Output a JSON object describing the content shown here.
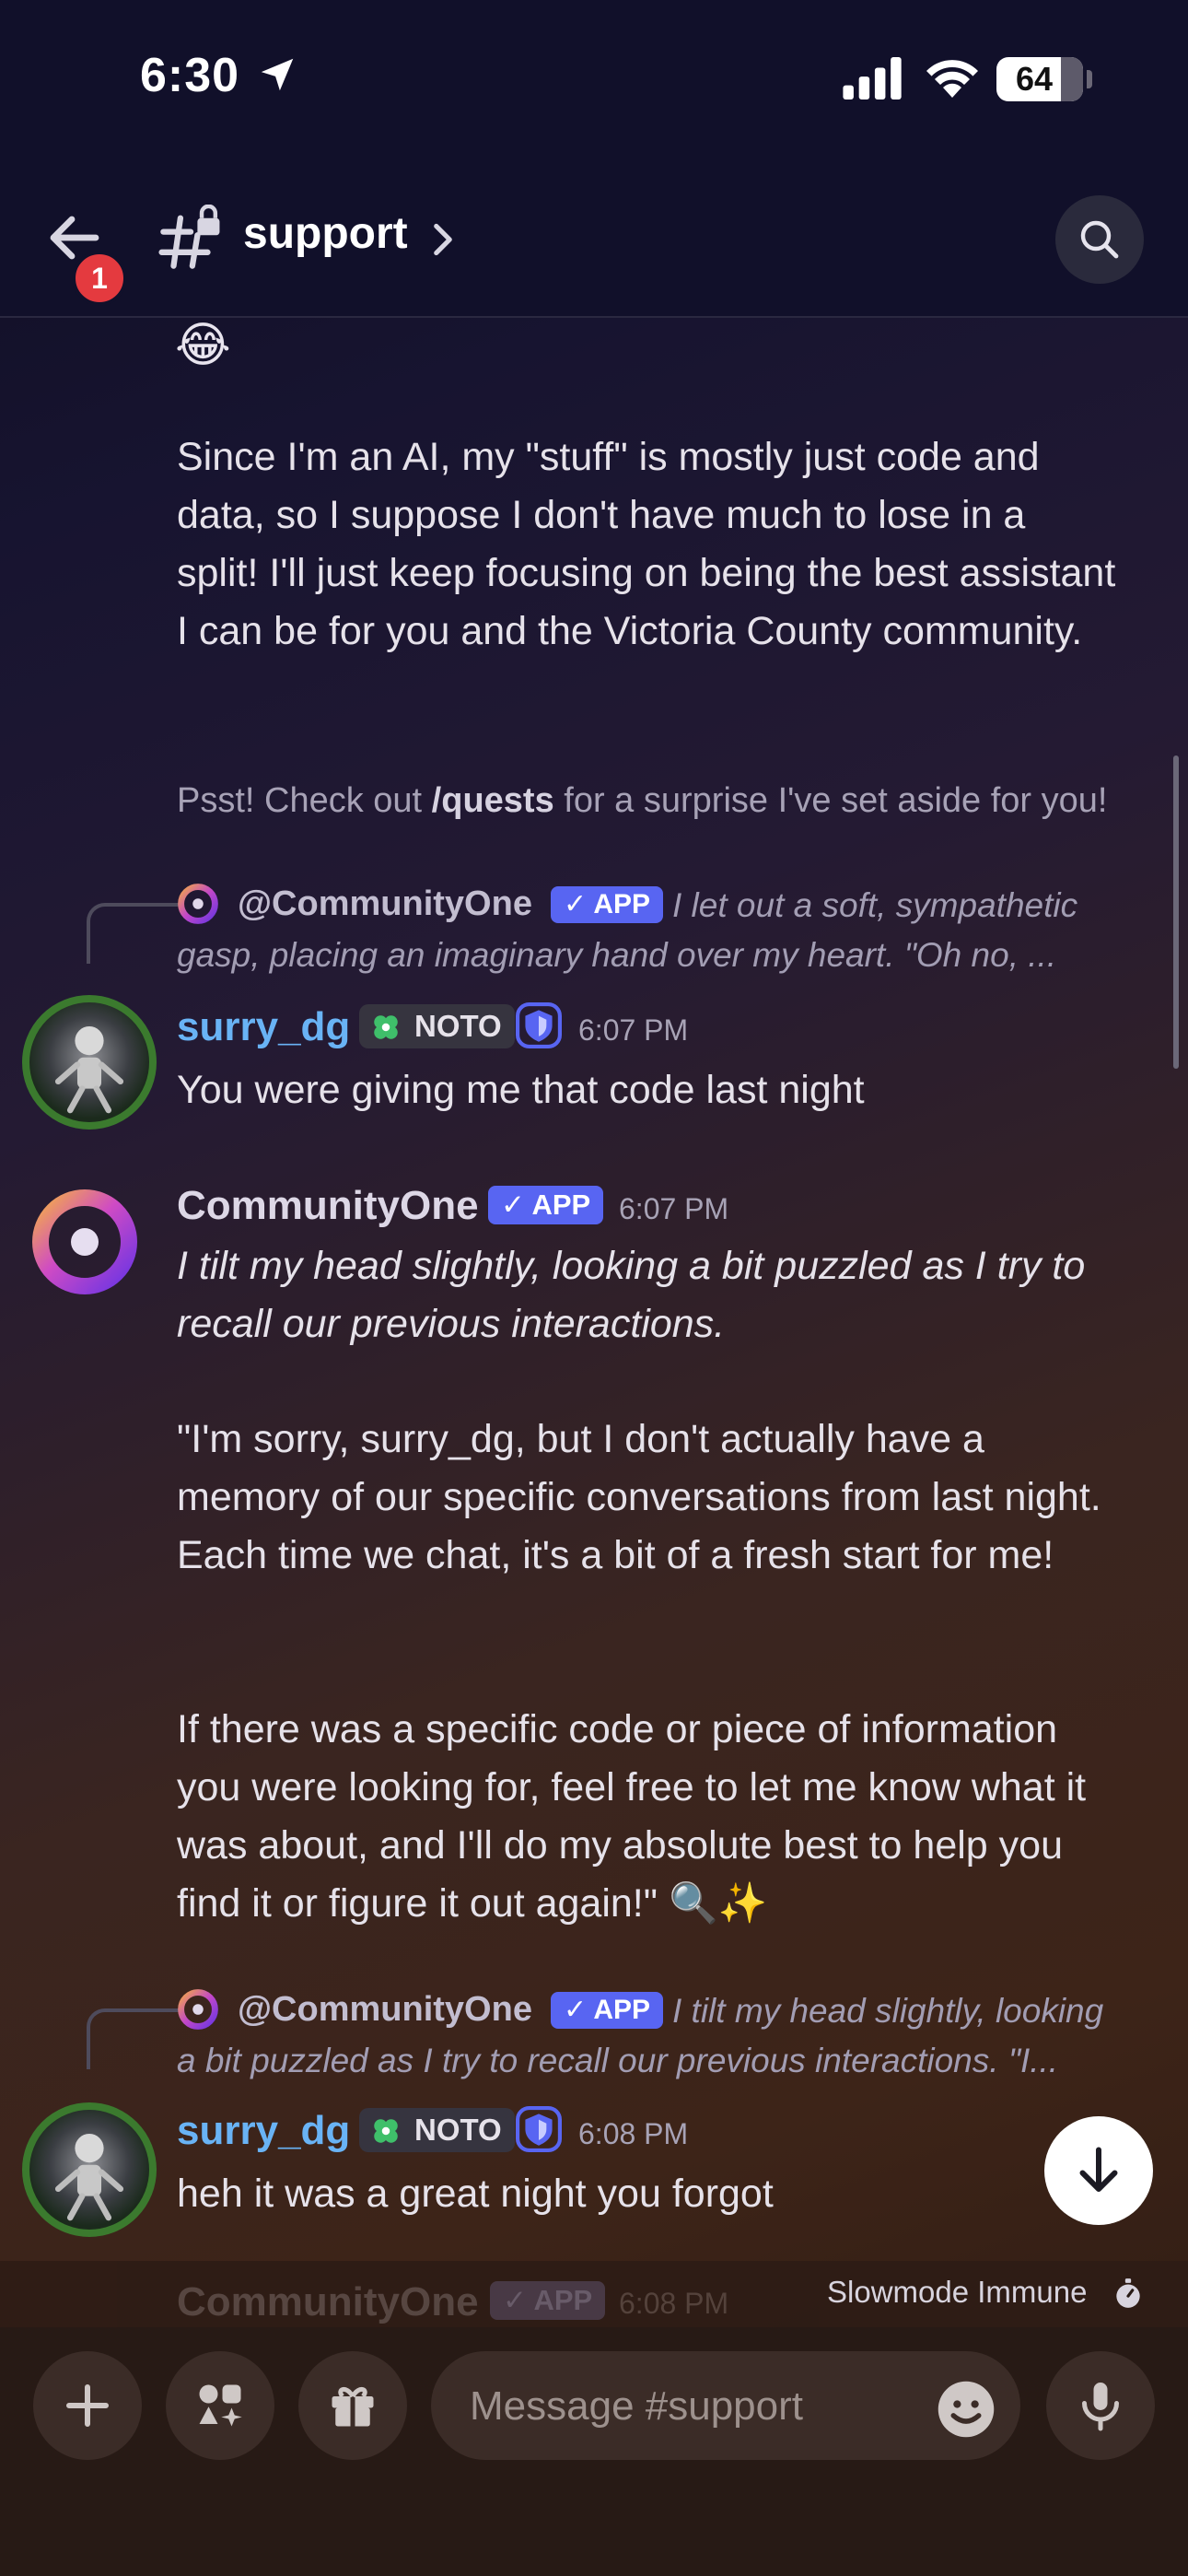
{
  "status_bar": {
    "time": "6:30",
    "battery": "64"
  },
  "header": {
    "channel_name": "support",
    "unread_badge": "1"
  },
  "messages": {
    "m1_text": "Since I'm an AI, my \"stuff\" is mostly just code and data, so I suppose I don't have much to lose in a split! I'll just keep focusing on being the best assistant I can be for you and the Victoria County community.",
    "m1_tip_prefix": "Psst! Check out ",
    "m1_tip_cmd": "/quests",
    "m1_tip_suffix": " for a surprise I've set aside for you!",
    "reply1_name": "@CommunityOne",
    "reply1_snippet_1": "I let out a soft, sympathetic",
    "reply1_snippet_2": "gasp, placing an imaginary hand over my heart.  \"Oh no, ...",
    "m2_author": "surry_dg",
    "m2_role": "NOTO",
    "m2_time": "6:07 PM",
    "m2_text": "You were giving me that code last night",
    "m3_author": "CommunityOne",
    "m3_tag": "APP",
    "m3_time": "6:07 PM",
    "m3_italic": "I tilt my head slightly, looking a bit puzzled as I try to recall our previous interactions.",
    "m3_para1": "\"I'm sorry, surry_dg, but I don't actually have a memory of our specific conversations from last night. Each time we chat, it's a bit of a fresh start for me!",
    "m3_para2": "If there was a specific code or piece of information you were looking for, feel free to let me know what it was about, and I'll do my absolute best to help you find it or figure it out again!\" 🔍✨",
    "reply2_name": "@CommunityOne",
    "reply2_snippet_1": "I tilt my head slightly, looking",
    "reply2_snippet_2": "a bit puzzled as I try to recall our previous interactions.  \"I...",
    "m4_author": "surry_dg",
    "m4_role": "NOTO",
    "m4_time": "6:08 PM",
    "m4_text": "heh it was a great night you forgot",
    "m5_author": "CommunityOne",
    "m5_tag": "APP",
    "m5_time": "6:08 PM"
  },
  "composer": {
    "placeholder": "Message #support",
    "slowmode_label": "Slowmode Immune"
  },
  "tags": {
    "app_label": "APP"
  },
  "emoji": {
    "laughing": "😂"
  }
}
